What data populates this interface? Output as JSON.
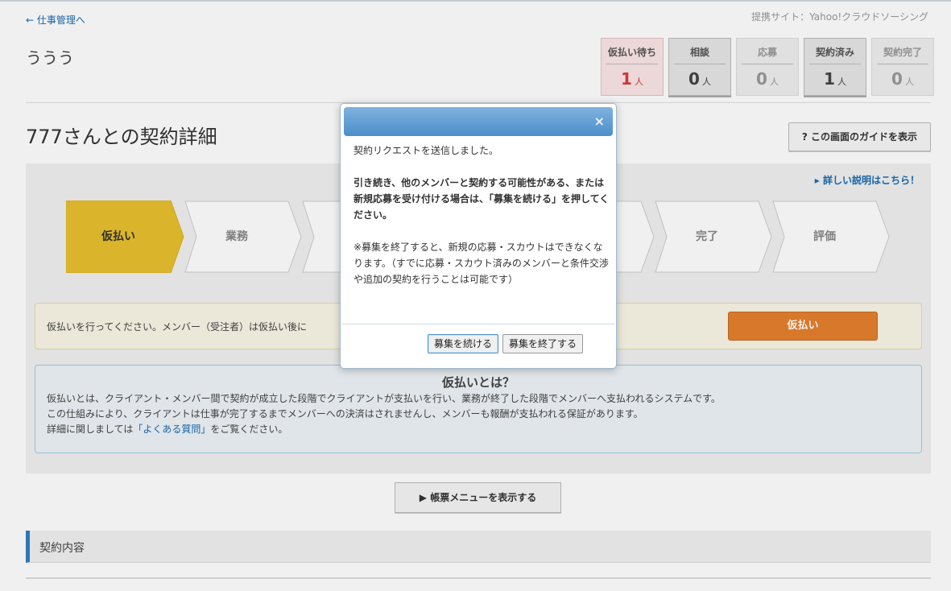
{
  "header": {
    "back_link": "← 仕事管理へ",
    "provider": "提携サイト：Yahoo!クラウドソーシング",
    "job_title": "ううう"
  },
  "status_tabs": [
    {
      "label": "仮払い待ち",
      "count": "1",
      "unit": "人",
      "state": "pending"
    },
    {
      "label": "相談",
      "count": "0",
      "unit": "人",
      "state": "normal"
    },
    {
      "label": "応募",
      "count": "0",
      "unit": "人",
      "state": "muted"
    },
    {
      "label": "契約済み",
      "count": "1",
      "unit": "人",
      "state": "active"
    },
    {
      "label": "契約完了",
      "count": "0",
      "unit": "人",
      "state": "muted"
    }
  ],
  "contract": {
    "title": "777さんとの契約詳細",
    "guide_button": "? この画面のガイドを表示",
    "detail_link": "▸ 詳しい説明はこちら！"
  },
  "steps": [
    {
      "label": "仮払い",
      "active": true
    },
    {
      "label": "業務",
      "active": false
    },
    {
      "label": "",
      "active": false
    },
    {
      "label": "",
      "active": false
    },
    {
      "label": "",
      "active": false
    },
    {
      "label": "完了",
      "active": false
    },
    {
      "label": "評価",
      "active": false
    }
  ],
  "notice": {
    "text": "仮払いを行ってください。メンバー（受注者）は仮払い後に",
    "pay_button": "仮払い"
  },
  "info": {
    "title": "仮払いとは？",
    "line1": "仮払いとは、クライアント・メンバー間で契約が成立した段階でクライアントが支払いを行い、業務が終了した段階でメンバーへ支払われるシステムです。",
    "line2": "この仕組みにより、クライアントは仕事が完了するまでメンバーへの決済はされませんし、メンバーも報酬が支払われる保証があります。",
    "line3_pre": "詳細に関しましては",
    "line3_link": "「よくある質問」",
    "line3_post": "をご覧ください。"
  },
  "ledger_button": "▶ 帳票メニューを表示する",
  "section_title": "契約内容",
  "dialog": {
    "close": "×",
    "message1": "契約リクエストを送信しました。",
    "message2": "引き続き、他のメンバーと契約する可能性がある、または新規応募を受け付ける場合は、「募集を続ける」を押してください。",
    "message3": "※募集を終了すると、新規の応募・スカウトはできなくなります。（すでに応募・スカウト済みのメンバーと条件交渉や追加の契約を行うことは可能です）",
    "continue_button": "募集を続ける",
    "end_button": "募集を終了する"
  },
  "colors": {
    "accent_blue": "#2f7fc1",
    "active_step": "#e8c12f",
    "pay_orange": "#e6802e",
    "pending_red": "#d63b3b"
  }
}
